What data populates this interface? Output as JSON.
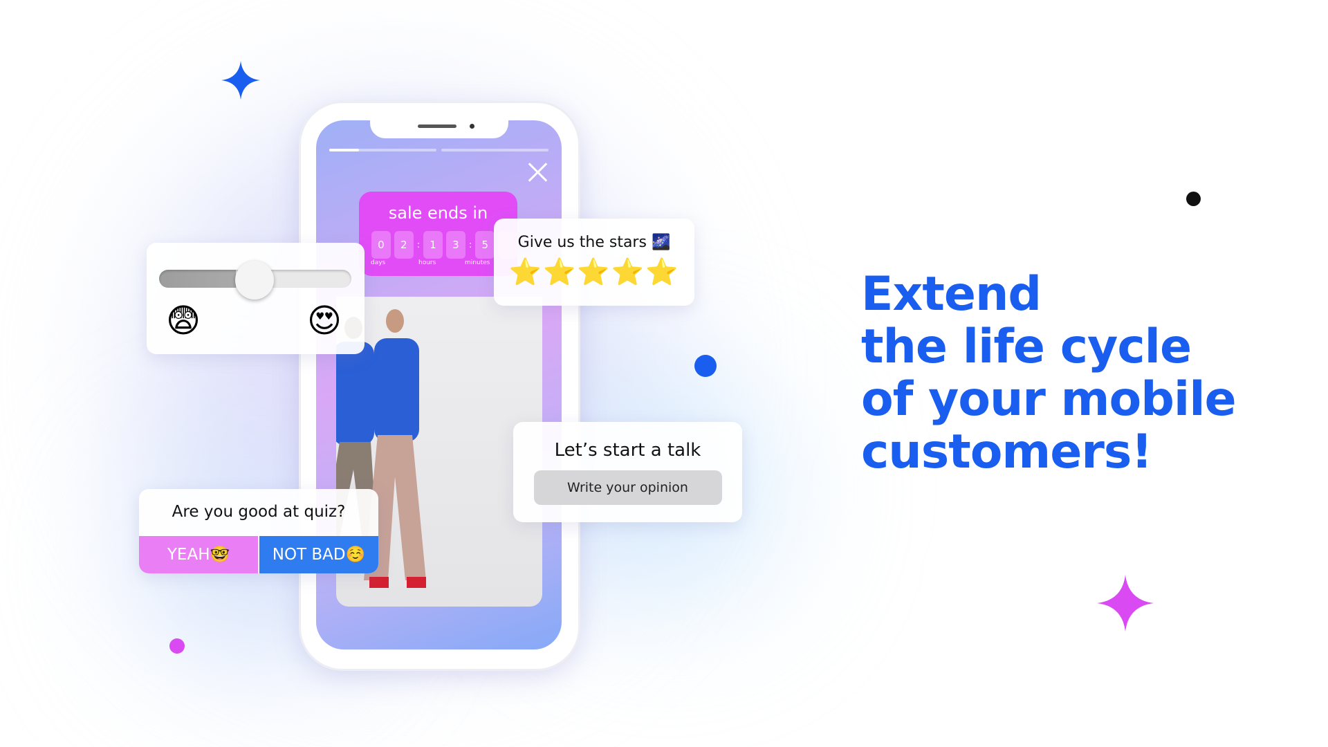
{
  "story": {
    "progress_segments": 2,
    "progress_first_fill": 0.28,
    "sale": {
      "title": "sale ends in",
      "digits": [
        "0",
        "2",
        "1",
        "3",
        "5"
      ],
      "units": [
        "days",
        "hours",
        "minutes"
      ]
    }
  },
  "slider_card": {
    "value": 0.45,
    "left_emoji": "😨",
    "right_emoji": "😍"
  },
  "stars_card": {
    "title": "Give us the stars",
    "title_emoji": "🌌",
    "stars": 5,
    "star_glyph": "⭐"
  },
  "talk_card": {
    "title": "Let’s start a talk",
    "input_placeholder": "Write your opinion"
  },
  "quiz_card": {
    "question": "Are you good at quiz?",
    "option_yes": "YEAH🤓",
    "option_notbad": "NOT BAD☺️"
  },
  "headline": {
    "lines": [
      "Extend",
      "the life cycle",
      "of your mobile",
      "customers!"
    ]
  },
  "colors": {
    "brand_blue": "#1a5ef0",
    "pink": "#e24cf7",
    "quiz_pink": "#ea7ff5",
    "quiz_blue": "#2f7cf0"
  }
}
